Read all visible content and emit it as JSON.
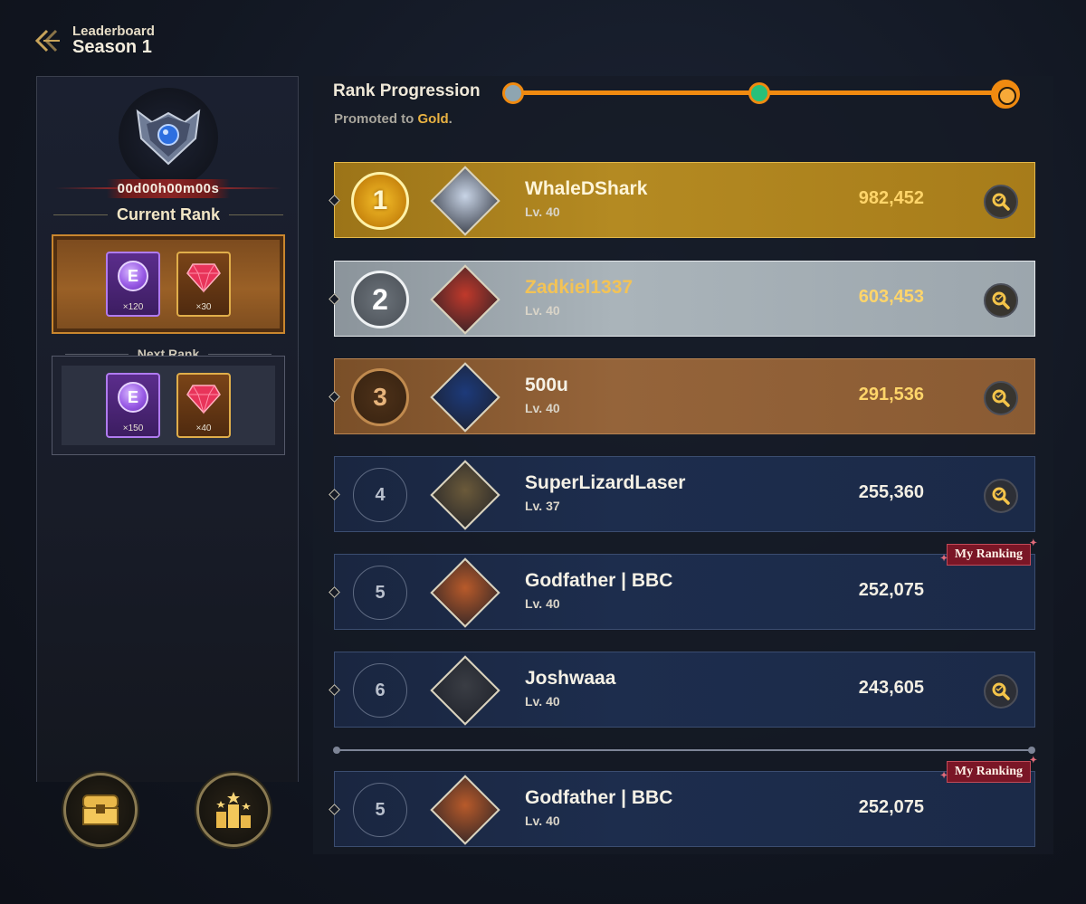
{
  "header": {
    "back_icon": "chevron-left-double-icon",
    "subtitle": "Leaderboard",
    "title": "Season 1"
  },
  "left_panel": {
    "emblem_icon": "rank-shield-emblem-icon",
    "timer": "00d00h00m00s",
    "current_rank_label": "Current Rank",
    "next_rank_label": "Next Rank",
    "current_rewards": [
      {
        "icon": "e-coin-icon",
        "letter": "E",
        "qty": "×120"
      },
      {
        "icon": "ruby-gem-icon",
        "qty": "×30"
      }
    ],
    "next_rewards": [
      {
        "icon": "e-coin-icon",
        "letter": "E",
        "qty": "×150"
      },
      {
        "icon": "ruby-gem-icon",
        "qty": "×40"
      }
    ],
    "buttons": [
      {
        "icon": "treasure-chest-icon"
      },
      {
        "icon": "podium-stars-icon"
      }
    ]
  },
  "progress": {
    "title": "Rank Progression",
    "subtitle_prefix": "Promoted to ",
    "subtitle_rank": "Gold",
    "subtitle_suffix": ".",
    "nodes": [
      "silver",
      "green",
      "gold"
    ],
    "accent": "#f08a10"
  },
  "rows": [
    {
      "rank": "1",
      "name": "WhaleDShark",
      "level": "Lv. 40",
      "score": "982,452",
      "tier": "gold",
      "inspect": true,
      "avatar_color": "#c8d4e6"
    },
    {
      "rank": "2",
      "name": "Zadkiel1337",
      "level": "Lv. 40",
      "score": "603,453",
      "tier": "silver",
      "inspect": true,
      "avatar_color": "#c0392b"
    },
    {
      "rank": "3",
      "name": "500u",
      "level": "Lv. 40",
      "score": "291,536",
      "tier": "bronze",
      "inspect": true,
      "avatar_color": "#1d3a7a"
    },
    {
      "rank": "4",
      "name": "SuperLizardLaser",
      "level": "Lv. 37",
      "score": "255,360",
      "tier": "plain",
      "inspect": true,
      "avatar_color": "#6b5a3a"
    },
    {
      "rank": "5",
      "name": "Godfather | BBC",
      "level": "Lv. 40",
      "score": "252,075",
      "tier": "plain",
      "inspect": false,
      "my_ranking": "My Ranking",
      "avatar_color": "#b85a2a"
    },
    {
      "rank": "6",
      "name": "Joshwaaa",
      "level": "Lv. 40",
      "score": "243,605",
      "tier": "plain",
      "inspect": true,
      "avatar_color": "#3a3d44"
    }
  ],
  "my_row": {
    "rank": "5",
    "name": "Godfather | BBC",
    "level": "Lv. 40",
    "score": "252,075",
    "tier": "plain",
    "my_ranking": "My Ranking",
    "avatar_color": "#b85a2a"
  }
}
